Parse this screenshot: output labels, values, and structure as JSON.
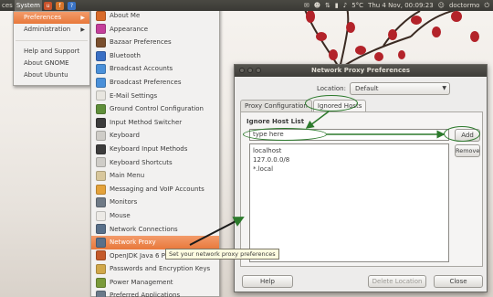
{
  "panel": {
    "menus": [
      "ces",
      "System"
    ],
    "time": "Thu 4 Nov, 00:09:23",
    "user": "doctormo",
    "temp": "5°C",
    "icons": [
      "ubuntu-icon",
      "firefox-icon",
      "help-icon",
      "mail-icon",
      "chat-icon",
      "network-icon",
      "battery-icon",
      "volume-icon",
      "power-icon"
    ]
  },
  "system_menu": {
    "items": [
      {
        "label": "Preferences",
        "sub": true,
        "selected": true
      },
      {
        "label": "Administration",
        "sub": true
      },
      {
        "label": "Help and Support"
      },
      {
        "label": "About GNOME"
      },
      {
        "label": "About Ubuntu"
      }
    ],
    "submenu_arrow": "▶"
  },
  "prefs_menu": {
    "scroll_up": "▲",
    "items": [
      {
        "label": "About Me",
        "color": "#d96b2a"
      },
      {
        "label": "Appearance",
        "color": "#c43f9a"
      },
      {
        "label": "Bazaar Preferences",
        "color": "#7a4f2e"
      },
      {
        "label": "Bluetooth",
        "color": "#3a6fc4"
      },
      {
        "label": "Broadcast Accounts",
        "color": "#4a90d9"
      },
      {
        "label": "Broadcast Preferences",
        "color": "#4a90d9"
      },
      {
        "label": "E-Mail Settings",
        "color": "#e8e6e0"
      },
      {
        "label": "Ground Control Configuration",
        "color": "#5f8f3a"
      },
      {
        "label": "Input Method Switcher",
        "color": "#3c3c3c"
      },
      {
        "label": "Keyboard",
        "color": "#cfcdc8"
      },
      {
        "label": "Keyboard Input Methods",
        "color": "#3c3c3c"
      },
      {
        "label": "Keyboard Shortcuts",
        "color": "#cfcdc8"
      },
      {
        "label": "Main Menu",
        "color": "#d8c79c"
      },
      {
        "label": "Messaging and VoIP Accounts",
        "color": "#e4a23a"
      },
      {
        "label": "Monitors",
        "color": "#6f7a86"
      },
      {
        "label": "Mouse",
        "color": "#eceae6"
      },
      {
        "label": "Network Connections",
        "color": "#59708a"
      },
      {
        "label": "Network Proxy",
        "color": "#59708a",
        "selected": true
      },
      {
        "label": "OpenJDK Java 6 Policy Tool",
        "color": "#c45a2a"
      },
      {
        "label": "Passwords and Encryption Keys",
        "color": "#d1a84a"
      },
      {
        "label": "Power Management",
        "color": "#7a9a3a"
      },
      {
        "label": "Preferred Applications",
        "color": "#6a7a8a"
      }
    ]
  },
  "tooltip": "Set your network proxy preferences",
  "window": {
    "title": "Network Proxy Preferences",
    "location_label": "Location:",
    "location_value": "Default",
    "dropdown_icon": "▼",
    "tabs": [
      "Proxy Configuration",
      "Ignored Hosts"
    ],
    "active_tab": 1,
    "section_title": "Ignore Host List",
    "host_input_value": "type here",
    "add_label": "Add",
    "remove_label": "Remove",
    "hosts": [
      "localhost",
      "127.0.0.0/8",
      "*.local"
    ],
    "help_label": "Help",
    "delete_location_label": "Delete Location",
    "close_label": "Close"
  },
  "colors": {
    "accent": "#e8783b",
    "callout": "#2c7a2c"
  }
}
